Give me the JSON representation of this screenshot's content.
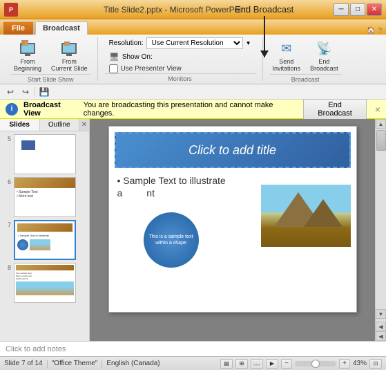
{
  "window": {
    "title": "Title Slide2.pptx - Microsoft PowerPoint",
    "icon": "P"
  },
  "tabs": {
    "file": "File",
    "broadcast": "Broadcast"
  },
  "ribbon": {
    "groups": {
      "start_slide_show": {
        "label": "Start Slide Show",
        "from_beginning": "From\nBeginning",
        "from_current": "From\nCurrent Slide"
      },
      "monitors": {
        "label": "Monitors",
        "resolution_label": "Resolution:",
        "resolution_value": "Use Current Resolution",
        "show_on_label": "Show On:",
        "presenter_view": "Use Presenter View"
      },
      "broadcast": {
        "label": "Broadcast",
        "send_invitations": "Send\nInvitations",
        "end_broadcast": "End\nBroadcast"
      }
    }
  },
  "broadcast_bar": {
    "icon": "i",
    "view_label": "Broadcast View",
    "message": "You are broadcasting this presentation and cannot make changes.",
    "end_button": "End Broadcast",
    "close": "×"
  },
  "slide_panel": {
    "tabs": [
      "Slides",
      "Outline"
    ],
    "slides": [
      {
        "num": "5"
      },
      {
        "num": "6"
      },
      {
        "num": "7"
      },
      {
        "num": "8"
      }
    ]
  },
  "slide": {
    "title_placeholder": "Click to add title",
    "bullet_text": "• Sample Text to illustrate",
    "bullet_cont": "a          nt",
    "circle_text": "This is a sample text within a shape",
    "border_label": "selection border"
  },
  "notes": {
    "placeholder": "Click to add notes"
  },
  "status_bar": {
    "slide_info": "Slide 7 of 14",
    "theme": "\"Office Theme\"",
    "language": "English (Canada)",
    "zoom": "43%"
  },
  "annotation": {
    "label": "End Broadcast"
  }
}
